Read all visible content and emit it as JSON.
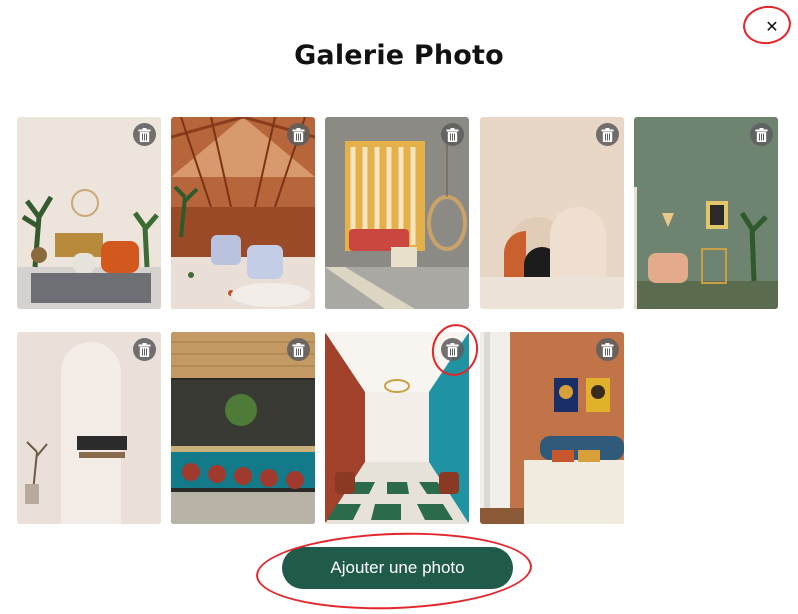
{
  "modal": {
    "title": "Galerie Photo",
    "close_icon": "close-icon",
    "close_label": "✕",
    "add_button_label": "Ajouter une photo",
    "accent_color": "#1f5a4a",
    "annotation_color": "#e3262b"
  },
  "gallery": {
    "photos": [
      {
        "subject": "boho living room with orange armchair",
        "delete_icon": "trash-icon"
      },
      {
        "subject": "greenhouse restaurant with wooden roof",
        "delete_icon": "trash-icon"
      },
      {
        "subject": "sunny room with wooden screen and rattan chair",
        "delete_icon": "trash-icon"
      },
      {
        "subject": "beige arches wall decor",
        "delete_icon": "trash-icon"
      },
      {
        "subject": "sage green room with pink armchair",
        "delete_icon": "trash-icon"
      },
      {
        "subject": "white arched room with black sofa",
        "delete_icon": "trash-icon"
      },
      {
        "subject": "bar with teal counter and red stools",
        "delete_icon": "trash-icon"
      },
      {
        "subject": "long dining hall with checkered floor",
        "delete_icon": "trash-icon"
      },
      {
        "subject": "terracotta bedroom with portraits",
        "delete_icon": "trash-icon"
      }
    ]
  }
}
